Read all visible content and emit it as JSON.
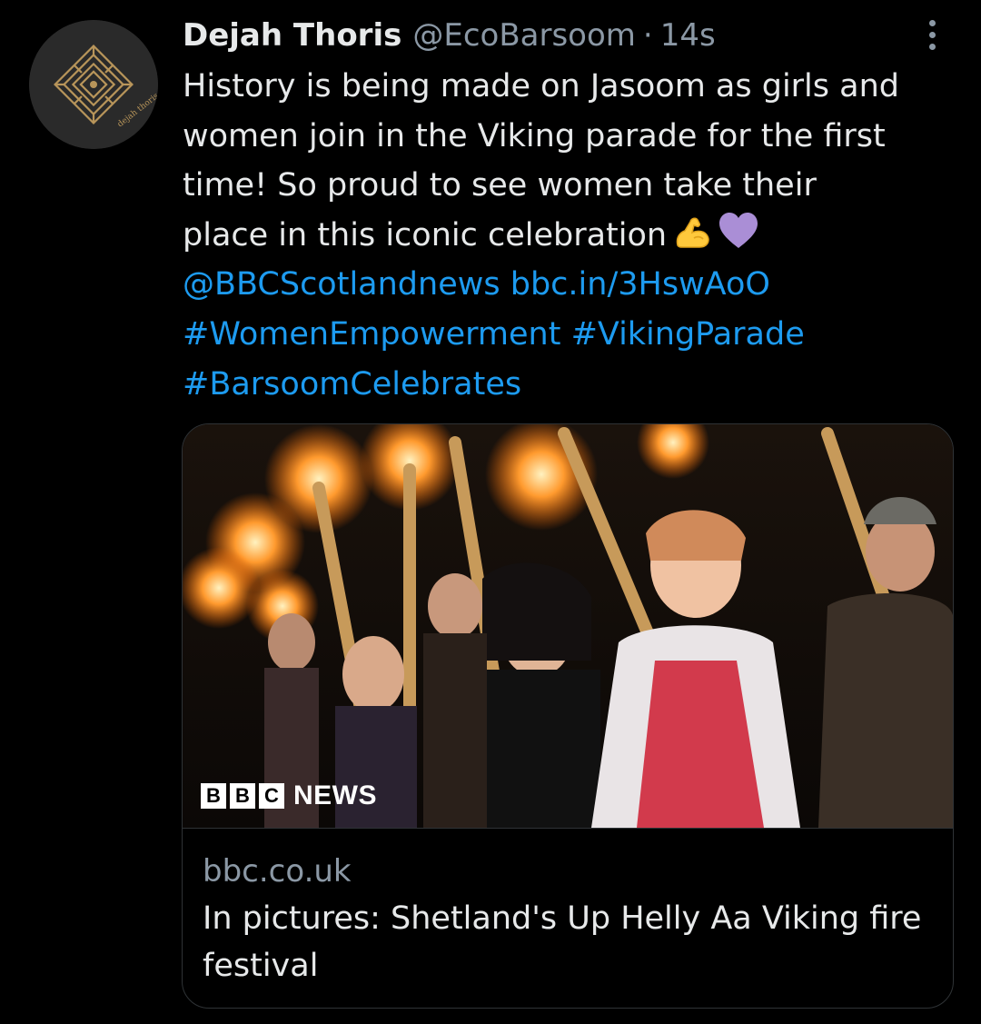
{
  "author": {
    "display_name": "Dejah Thoris",
    "handle": "@EcoBarsoom",
    "separator": "·",
    "time": "14s",
    "avatar_text": "dejah thoris"
  },
  "menu_icon": "more-vertical-icon",
  "tweet": {
    "line1": "History is being made on Jasoom as girls and",
    "line2": "women join in the Viking parade for the first",
    "line3": "time! So proud to see women take their",
    "line4": "place in this iconic celebration",
    "emoji_1": "flexed-biceps-emoji",
    "emoji_2": "purple-heart-emoji",
    "mention": "@BBCScotlandnews",
    "url": "bbc.in/3HswAoO",
    "hashtag_1": "#WomenEmpowerment",
    "hashtag_2": "#VikingParade",
    "hashtag_3": "#BarsoomCelebrates"
  },
  "card": {
    "image_logo": {
      "box_1": "B",
      "box_2": "B",
      "box_3": "C",
      "word": "NEWS"
    },
    "domain": "bbc.co.uk",
    "title": "In pictures: Shetland's Up Helly Aa Viking fire festival"
  },
  "colors": {
    "background": "#000000",
    "text": "#e7e9ea",
    "secondary": "#8b98a5",
    "link": "#1d9bf0",
    "border": "#2f3336",
    "avatar_gold": "#b8955a"
  }
}
